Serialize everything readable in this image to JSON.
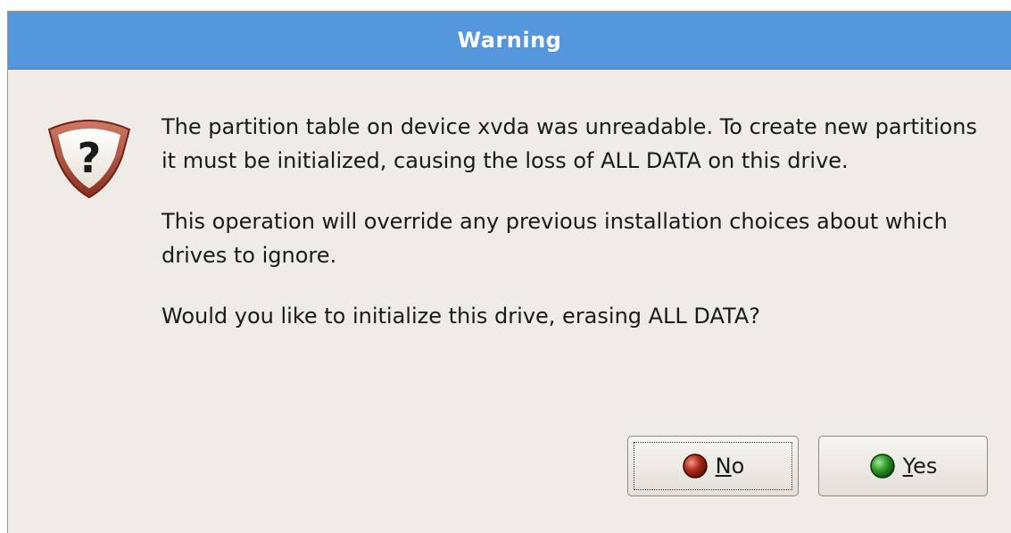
{
  "dialog": {
    "title": "Warning",
    "icon": "question-shield-icon",
    "paragraphs": [
      "The partition table on device xvda was unreadable. To create new partitions it must be initialized, causing the loss of ALL DATA on this drive.",
      "This operation will override any previous installation choices about which drives to ignore.",
      "Would you like to initialize this drive, erasing ALL DATA?"
    ],
    "buttons": {
      "no": {
        "label": "No",
        "icon": "red-ball-icon",
        "color": "#b02a1a"
      },
      "yes": {
        "label": "Yes",
        "icon": "green-ball-icon",
        "color": "#2f9a2a"
      }
    }
  },
  "colors": {
    "titlebar": "#5597dd",
    "background": "#efebe7"
  }
}
